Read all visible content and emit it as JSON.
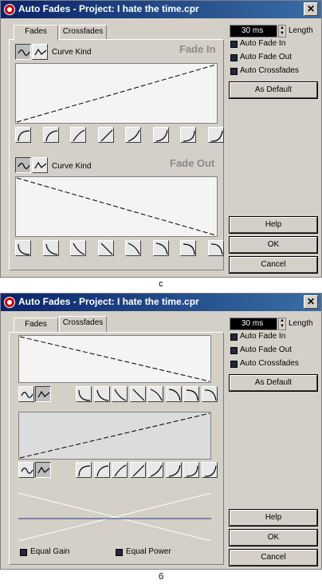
{
  "dialog_a": {
    "title": "Auto Fades - Project: I hate the time.cpr",
    "tabs": [
      "Fades",
      "Crossfades"
    ],
    "length_value": "30 ms",
    "length_label": "Length",
    "checkboxes": [
      "Auto Fade In",
      "Auto Fade Out",
      "Auto Crossfades"
    ],
    "as_default": "As Default",
    "curve_kind_label_1": "Curve Kind",
    "curve_kind_label_2": "Curve Kind",
    "fade_in_label": "Fade In",
    "fade_out_label": "Fade Out",
    "help": "Help",
    "ok": "OK",
    "cancel": "Cancel",
    "caption": "c"
  },
  "dialog_b": {
    "title": "Auto Fades - Project: I hate the time.cpr",
    "tabs": [
      "Fades",
      "Crossfades"
    ],
    "length_value": "30 ms",
    "length_label": "Length",
    "checkboxes": [
      "Auto Fade In",
      "Auto Fade Out",
      "Auto Crossfades"
    ],
    "as_default": "As Default",
    "equal_gain": "Equal Gain",
    "equal_power": "Equal Power",
    "help": "Help",
    "ok": "OK",
    "cancel": "Cancel",
    "caption": "б"
  },
  "icons": {
    "app": "cubase-logo-icon",
    "close": "close-icon",
    "spline_curve": "spline-curve-icon",
    "damped_spline": "damped-spline-icon",
    "fade_shape": "fade-shape-preset-icon"
  }
}
